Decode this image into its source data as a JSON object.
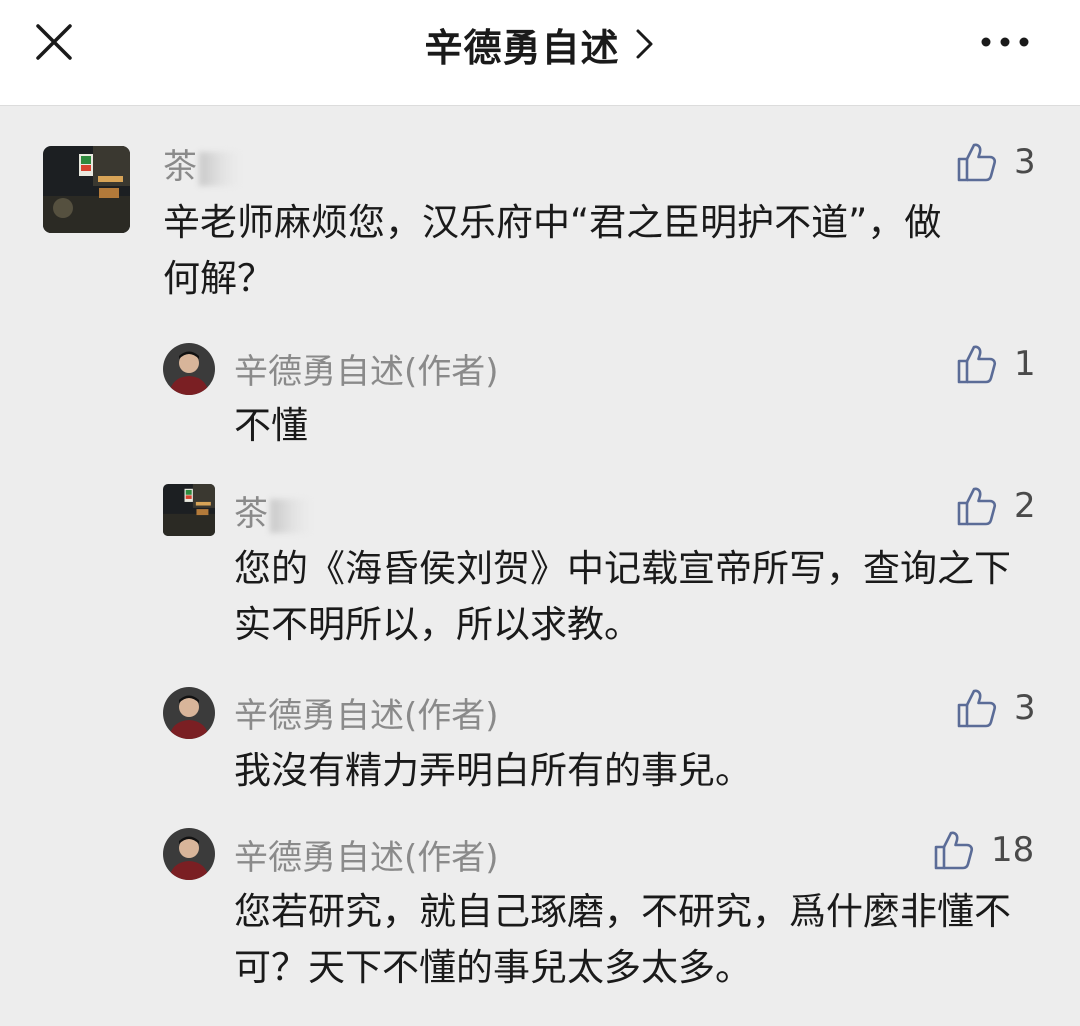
{
  "header": {
    "title": "辛德勇自述"
  },
  "comments": [
    {
      "author": "茶",
      "text": "辛老师麻烦您，汉乐府中“君之臣明护不道”，做何解？",
      "likes": "3",
      "replies": [
        {
          "author": "辛德勇自述(作者)",
          "text": "不懂",
          "likes": "1"
        },
        {
          "author": "茶",
          "text": "您的《海昏侯刘贺》中记载宣帝所写，查询之下实不明所以，所以求教。",
          "likes": "2"
        },
        {
          "author": "辛德勇自述(作者)",
          "text": "我沒有精力弄明白所有的事兒。",
          "likes": "3"
        },
        {
          "author": "辛德勇自述(作者)",
          "text": "您若研究，就自己琢磨，不研究，爲什麼非懂不可？天下不懂的事兒太多太多。",
          "likes": "18"
        }
      ]
    }
  ],
  "colors": {
    "background": "#ededed",
    "header_bg": "#ffffff",
    "name_gray": "#8a8a8a",
    "like_blue": "#5b6c97"
  },
  "icons": [
    "close-icon",
    "chevron-right-icon",
    "more-icon",
    "thumbs-up-icon"
  ]
}
